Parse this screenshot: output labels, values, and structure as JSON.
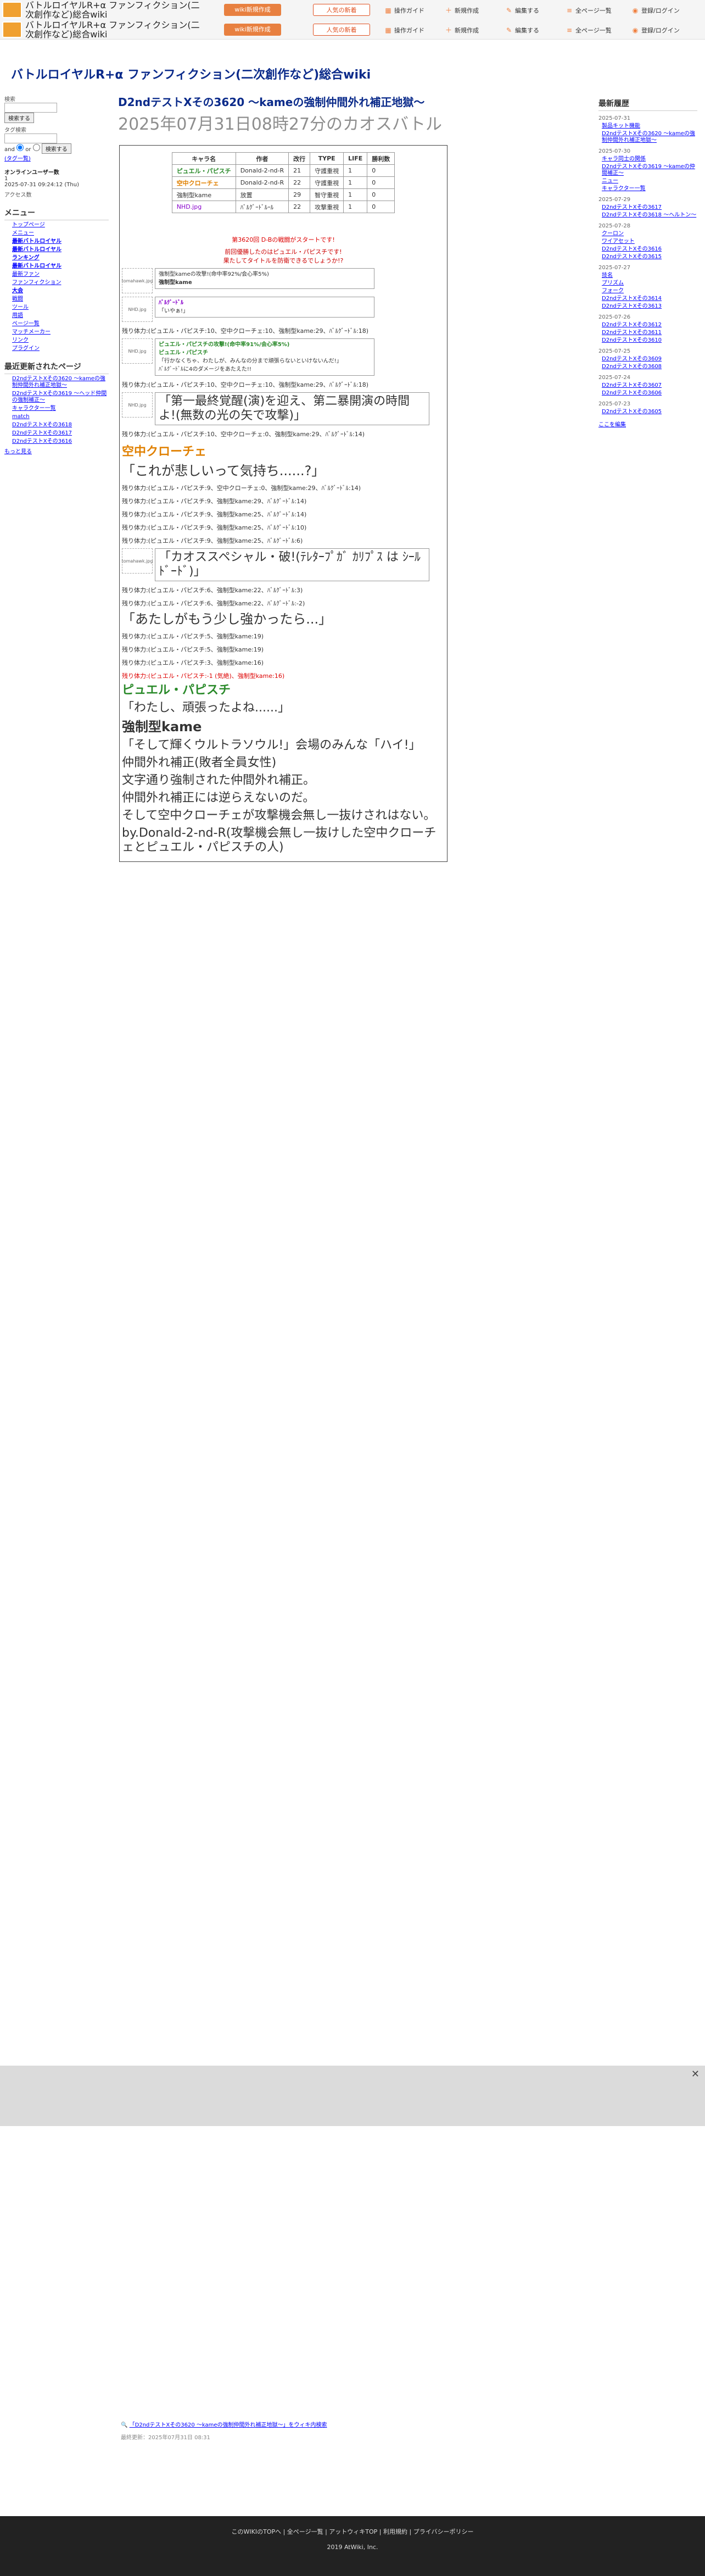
{
  "topbar": {
    "title": "バトルロイヤルR+α ファンフィクション(二次創作など)総合wiki",
    "btn_top": "wiki新規作成",
    "btn_popular": "人気の新着",
    "menu": [
      "操作ガイド",
      "新規作成",
      "編集する",
      "全ページ一覧",
      "登録/ログイン"
    ]
  },
  "site_title": "バトルロイヤルR+α ファンフィクション(二次創作など)総合wiki",
  "left": {
    "search_label": "検索",
    "search_btn": "検索する",
    "tag_label": "タグ検索",
    "tag_btn": "検索する",
    "and": "and",
    "or": "or",
    "tag_list": "(タグ一覧)",
    "online": "オンラインユーザー数",
    "online_count": "1",
    "datetime": "2025-07-31 09:24:12 (Thu)",
    "access": "アクセス数",
    "menu_head": "メニュー",
    "menu": [
      "トップページ",
      "メニュー",
      "最新バトルロイヤル",
      "最新バトルロイヤル",
      "ランキング",
      "最新バトルロイヤル",
      "最新ファン",
      "ファンフィクション",
      "大会",
      "戦闘",
      "ツール",
      "用語",
      "ページ一覧",
      "マッチメーカー",
      "リンク",
      "プラグイン"
    ],
    "recent_head": "最近更新されたページ",
    "recent": [
      "D2ndテストXその3620 〜kameの強制仲間外れ補正地獄〜",
      "D2ndテストXその3619 〜ヘッド仲間の強制補正〜",
      "キャラクター一覧",
      "match",
      "D2ndテストXその3618",
      "D2ndテストXその3617",
      "D2ndテストXその3616",
      "もっと見る"
    ],
    "more": "もっと見る"
  },
  "main": {
    "h1": "D2ndテストXその3620 〜kameの強制仲間外れ補正地獄〜",
    "h2": "2025年07月31日08時27分のカオスバトル"
  },
  "participants": {
    "headers": [
      "キャラ名",
      "作者",
      "改行",
      "TYPE",
      "LIFE",
      "勝利数"
    ],
    "rows": [
      [
        "ピュエル・パピスチ",
        "Donald-2-nd-R",
        "21",
        "守護重視",
        "1",
        "0"
      ],
      [
        "空中クローチェ",
        "Donald-2-nd-R",
        "22",
        "守護重視",
        "1",
        "0"
      ],
      [
        "強制型kame",
        "放置",
        "29",
        "智守重視",
        "1",
        "0"
      ],
      [
        "NHD.jpg",
        "ﾊﾞﾙｸﾞｰﾄﾞﾙｰﾙ",
        "22",
        "攻撃重視",
        "1",
        "0"
      ]
    ]
  },
  "battle": {
    "start": "第3620回 D-Bの戦闘がスタートです!",
    "intro": "前回優勝したのはピュエル・パピスチです!\n果たしてタイトルを防衛できるでしょうか!?",
    "img1": "tomahawk.jpg",
    "img2": "NHD.jpg",
    "turns": [
      "残り体力:(ピュエル・パピスチ:10、空中クローチェ:10、強制型kame:29、ﾊﾞﾙｸﾞｰﾄﾞﾙ:18)",
      "残り体力:(ピュエル・パピスチ:10、空中クローチェ:10、強制型kame:29、ﾊﾞﾙｸﾞｰﾄﾞﾙ:18)",
      "残り体力:(ピュエル・パピスチ:10、空中クローチェ:0、強制型kame:29、ﾊﾞﾙｸﾞｰﾄﾞﾙ:14)"
    ],
    "messages": [
      {
        "name": "強制型kame",
        "text": "強制型kameの攻撃!(命中率92%/会心率5%)"
      },
      {
        "name": "ﾊﾞﾙｸﾞｰﾄﾞﾙ",
        "text": "「いやぁ!」"
      },
      {
        "name": "ピュエル・パピスチ",
        "text": "ピュエル・パピスチの攻撃!(命中率91%/会心率5%)"
      },
      {
        "name": "ピュエル・パピスチ",
        "text": "「行かなくちゃ、わたしが、みんなの分まで頑張らないといけないんだ!」"
      },
      {
        "name": "ﾊﾞﾙｸﾞｰﾄﾞﾙ",
        "text": "ﾊﾞﾙｸﾞｰﾄﾞﾙに4のダメージをあたえた!!"
      }
    ],
    "big1": "「第一最終覚醒(演)を迎え、第二暴開演の時間よ!(無数の光の矢で攻撃)」",
    "big2": "「これが悲しいって気持ち......?」",
    "big3": "「カオススペシャル・破!(ﾃﾚﾀｰﾌﾟｶﾞ ｶﾘﾌﾟｽ は ｼｰﾙﾄﾞｰﾄﾞ)」",
    "big4": "「あたしがもう少し強かったら...」",
    "big5": "「わたし、頑張ったよね......」",
    "end1": "強制型kame",
    "end2": "「そして輝くウルトラソウル!」会場のみんな「ハイ!」",
    "end3": "仲間外れ補正(敗者全員女性)",
    "end4": "文字通り強制された仲間外れ補正。",
    "end5": "仲間外れ補正には逆らえないのだ。",
    "end6": "そして空中クローチェが攻撃機会無し一抜けされはない。",
    "end7": "by.Donald-2-nd-R(攻撃機会無し一抜けした空中クローチェとピュエル・パピスチの人)",
    "remains": [
      "残り体力:(ピュエル・パピスチ:9、空中クローチェ:0、強制型kame:29、ﾊﾞﾙｸﾞｰﾄﾞﾙ:14)",
      "残り体力:(ピュエル・パピスチ:9、強制型kame:29、ﾊﾞﾙｸﾞｰﾄﾞﾙ:14)",
      "残り体力:(ピュエル・パピスチ:9、強制型kame:25、ﾊﾞﾙｸﾞｰﾄﾞﾙ:14)",
      "残り体力:(ピュエル・パピスチ:9、強制型kame:25、ﾊﾞﾙｸﾞｰﾄﾞﾙ:10)",
      "残り体力:(ピュエル・パピスチ:9、強制型kame:25、ﾊﾞﾙｸﾞｰﾄﾞﾙ:6)",
      "残り体力:(ピュエル・パピスチ:6、強制型kame:22、ﾊﾞﾙｸﾞｰﾄﾞﾙ:3)",
      "残り体力:(ピュエル・パピスチ:6、強制型kame:22、ﾊﾞﾙｸﾞｰﾄﾞﾙ:-2)",
      "残り体力:(ピュエル・パピスチ:5、強制型kame:19)",
      "残り体力:(ピュエル・パピスチ:5、強制型kame:19)",
      "残り体力:(ピュエル・パピスチ:3、強制型kame:16)",
      "残り体力:(ピュエル・パピスチ:-1 (気絶)、強制型kame:16)"
    ]
  },
  "right": {
    "head": "最新履歴",
    "groups": [
      {
        "date": "2025-07-31",
        "items": [
          "製品キット機能",
          "D2ndテストXその3620 〜kameの強制仲間外れ補正地獄〜"
        ]
      },
      {
        "date": "2025-07-30",
        "items": [
          "キャラ同士の関係",
          "D2ndテストXその3619 〜kameの仲間補正〜",
          "ニュー",
          "キャラクター一覧"
        ]
      },
      {
        "date": "2025-07-29",
        "items": [
          "D2ndテストXその3617",
          "D2ndテストXその3618 〜ヘルトン〜"
        ]
      },
      {
        "date": "2025-07-28",
        "items": [
          "クーロン",
          "ワイアセット",
          "D2ndテストXその3616",
          "D2ndテストXその3615"
        ]
      },
      {
        "date": "2025-07-27",
        "items": [
          "技名",
          "プリズム",
          "フォーク",
          "D2ndテストXその3614",
          "D2ndテストXその3613"
        ]
      },
      {
        "date": "2025-07-26",
        "items": [
          "D2ndテストXその3612",
          "D2ndテストXその3611",
          "D2ndテストXその3610"
        ]
      },
      {
        "date": "2025-07-25",
        "items": [
          "D2ndテストXその3609",
          "D2ndテストXその3608"
        ]
      },
      {
        "date": "2025-07-24",
        "items": [
          "D2ndテストXその3607",
          "D2ndテストXその3606"
        ]
      },
      {
        "date": "2025-07-23",
        "items": [
          "D2ndテストXその3605"
        ]
      }
    ],
    "more": "ここを編集"
  },
  "footer": {
    "link": "「D2ndテストXその3620 〜kameの強制仲間外れ補正地獄〜」をウィキ内検索",
    "updated": "最終更新：2025年07月31日 08:31",
    "links": "このWIKIのTOPへ | 全ページ一覧 | アットウィキTOP | 利用規約 | プライバシーポリシー",
    "copy": "2019 AtWiki, Inc."
  }
}
